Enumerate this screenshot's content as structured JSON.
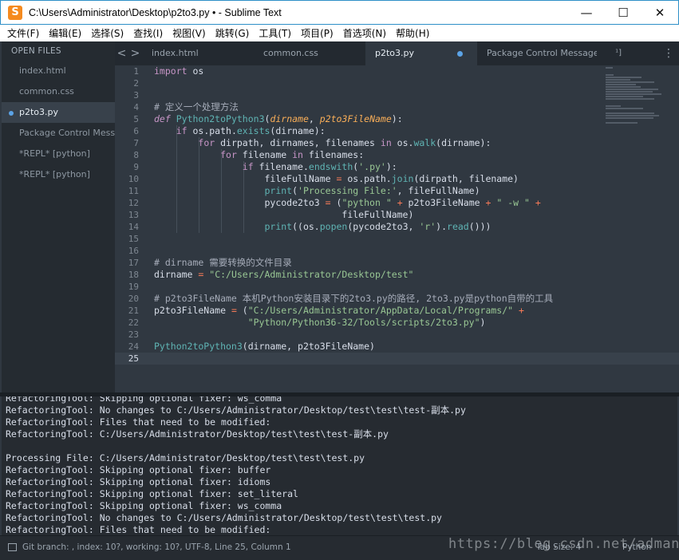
{
  "window": {
    "title": "C:\\Users\\Administrator\\Desktop\\p2to3.py • - Sublime Text",
    "app_icon": "S",
    "minimize": "—",
    "maximize": "☐",
    "close": "✕"
  },
  "menu": [
    "文件(F)",
    "编辑(E)",
    "选择(S)",
    "查找(I)",
    "视图(V)",
    "跳转(G)",
    "工具(T)",
    "项目(P)",
    "首选项(N)",
    "帮助(H)"
  ],
  "sidebar": {
    "header": "OPEN FILES",
    "files": [
      "index.html",
      "common.css",
      "p2to3.py",
      "Package Control Messages",
      "*REPL* [python]",
      "*REPL* [python]"
    ]
  },
  "tabs": {
    "nav_prev": "<",
    "nav_next": ">",
    "items": [
      "index.html",
      "common.css",
      "p2to3.py",
      "Package Control Messages"
    ],
    "overflow": "¹]",
    "menu": "⋮"
  },
  "editor": {
    "line_numbers": [
      "1",
      "2",
      "3",
      "4",
      "5",
      "6",
      "7",
      "8",
      "9",
      "10",
      "11",
      "12",
      "13",
      "14",
      "15",
      "16",
      "17",
      "18",
      "19",
      "20",
      "21",
      "22",
      "23",
      "24",
      "25"
    ],
    "lines": [
      "import os",
      "",
      "",
      "# 定义一个处理方法",
      "def Python2toPython3(dirname, p2to3FileName):",
      "    if os.path.exists(dirname):",
      "        for dirpath, dirnames, filenames in os.walk(dirname):",
      "            for filename in filenames:",
      "                if filename.endswith('.py'):",
      "                    fileFullName = os.path.join(dirpath, filename)",
      "                    print('Processing File:', fileFullName)",
      "                    pycode2to3 = (\"python \" + p2to3FileName + \" -w \" +",
      "                                  fileFullName)",
      "                    print((os.popen(pycode2to3, 'r').read()))",
      "",
      "",
      "# dirname 需要转换的文件目录",
      "dirname = \"C:/Users/Administrator/Desktop/test\"",
      "",
      "# p2to3FileName 本机Python安装目录下的2to3.py的路径, 2to3.py是python自带的工具",
      "p2to3FileName = (\"C:/Users/Administrator/AppData/Local/Programs/\" +",
      "                 \"Python/Python36-32/Tools/scripts/2to3.py\")",
      "",
      "Python2toPython3(dirname, p2to3FileName)",
      ""
    ]
  },
  "output": [
    "RefactoringTool: Skipping optional fixer: ws_comma",
    "RefactoringTool: No changes to C:/Users/Administrator/Desktop/test\\test\\test-副本.py",
    "RefactoringTool: Files that need to be modified:",
    "RefactoringTool: C:/Users/Administrator/Desktop/test\\test\\test-副本.py",
    "",
    "Processing File: C:/Users/Administrator/Desktop/test\\test\\test.py",
    "RefactoringTool: Skipping optional fixer: buffer",
    "RefactoringTool: Skipping optional fixer: idioms",
    "RefactoringTool: Skipping optional fixer: set_literal",
    "RefactoringTool: Skipping optional fixer: ws_comma",
    "RefactoringTool: No changes to C:/Users/Administrator/Desktop/test\\test\\test.py",
    "RefactoringTool: Files that need to be modified:"
  ],
  "statusbar": {
    "text": "Git branch: , index: 10?, working: 10?, UTF-8, Line 25, Column 1",
    "tab_size": "Tab Size: 4",
    "syntax": "Python"
  },
  "watermark": "https://blog.csdn.net/admans",
  "colors": {
    "editor_bg": "#303841",
    "sidebar_bg": "#252b31",
    "keyword": "#c695c6",
    "string": "#99c794",
    "function": "#5fb4b4",
    "comment": "#a6acb9",
    "param": "#f9ae58"
  }
}
